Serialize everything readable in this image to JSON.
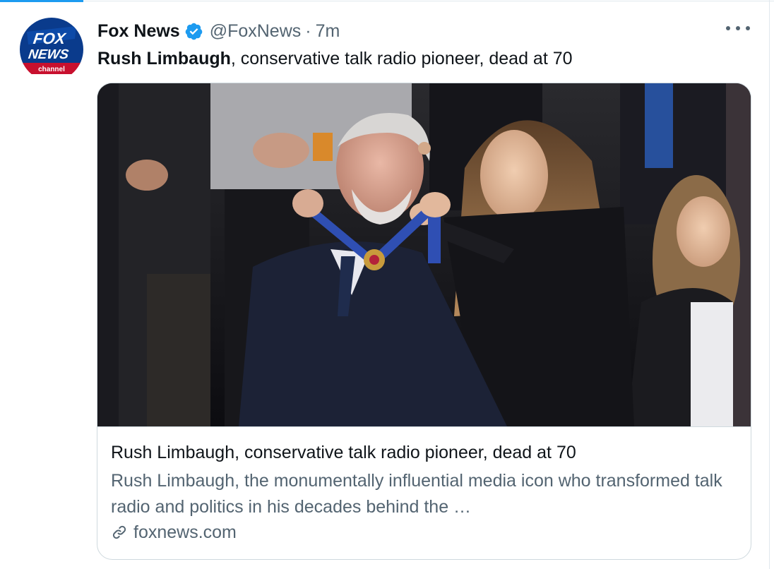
{
  "tweet": {
    "author": {
      "display_name": "Fox News",
      "handle": "@FoxNews",
      "verified": true,
      "avatar_logo": {
        "line1": "FOX",
        "line2": "NEWS",
        "line3": "channel"
      }
    },
    "separator": "·",
    "timestamp": "7m",
    "text_bold": "Rush Limbaugh",
    "text_rest": ", conservative talk radio pioneer, dead at 70",
    "more_icon": "more-horizontal-icon"
  },
  "card": {
    "image_icon": "news-photo",
    "title": "Rush Limbaugh, conservative talk radio pioneer, dead at 70",
    "description": "Rush Limbaugh, the monumentally influential media icon who transformed talk radio and politics in his decades behind the …",
    "domain": "foxnews.com",
    "domain_icon": "link-icon"
  },
  "colors": {
    "accent": "#1d9bf0",
    "text_primary": "#0f1419",
    "text_secondary": "#536471",
    "border": "#cfd9de",
    "fox_blue": "#0a3b8c",
    "fox_red": "#c8102e"
  }
}
